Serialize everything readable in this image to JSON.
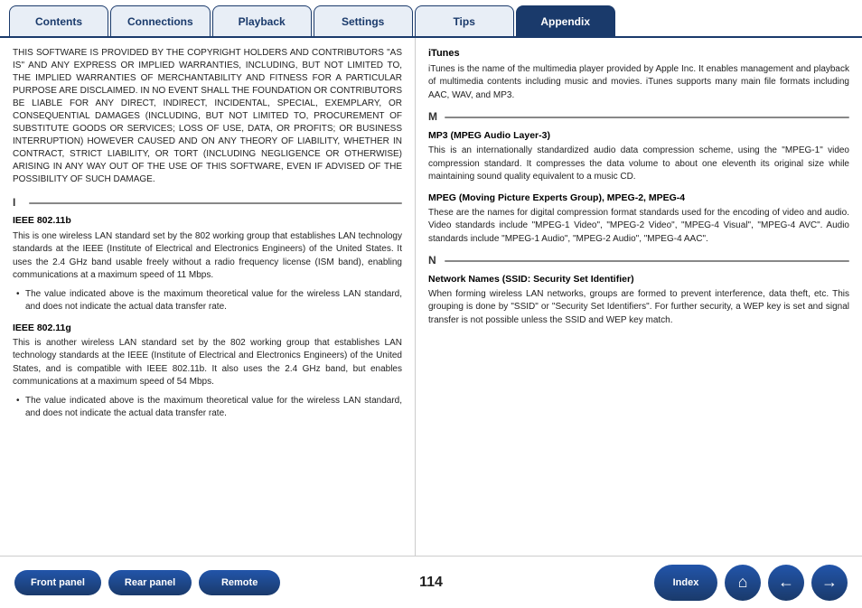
{
  "tabs": [
    {
      "label": "Contents",
      "active": false
    },
    {
      "label": "Connections",
      "active": false
    },
    {
      "label": "Playback",
      "active": false
    },
    {
      "label": "Settings",
      "active": false
    },
    {
      "label": "Tips",
      "active": false
    },
    {
      "label": "Appendix",
      "active": true
    }
  ],
  "left": {
    "copyright": "THIS SOFTWARE IS PROVIDED BY THE COPYRIGHT HOLDERS AND CONTRIBUTORS \"AS IS\" AND ANY EXPRESS OR IMPLIED WARRANTIES, INCLUDING, BUT NOT LIMITED TO, THE IMPLIED WARRANTIES OF MERCHANTABILITY AND FITNESS FOR A PARTICULAR PURPOSE ARE DISCLAIMED. IN NO EVENT SHALL THE FOUNDATION OR CONTRIBUTORS BE LIABLE FOR ANY DIRECT, INDIRECT, INCIDENTAL, SPECIAL, EXEMPLARY, OR CONSEQUENTIAL DAMAGES (INCLUDING, BUT NOT LIMITED TO, PROCUREMENT OF SUBSTITUTE GOODS OR SERVICES; LOSS OF USE, DATA, OR PROFITS; OR BUSINESS INTERRUPTION) HOWEVER CAUSED AND ON ANY THEORY OF LIABILITY, WHETHER IN CONTRACT, STRICT LIABILITY, OR TORT (INCLUDING NEGLIGENCE OR OTHERWISE) ARISING IN ANY WAY OUT OF THE USE OF THIS SOFTWARE, EVEN IF ADVISED OF THE POSSIBILITY OF SUCH DAMAGE.",
    "section_i_letter": "I",
    "ieee_802_11b_title": "IEEE 802.11b",
    "ieee_802_11b_body": "This is one wireless LAN standard set by the 802 working group that establishes LAN technology standards at the IEEE (Institute of Electrical and Electronics Engineers) of the United States. It uses the 2.4 GHz band usable freely without a radio frequency license (ISM band), enabling communications at a maximum speed of 11 Mbps.",
    "ieee_802_11b_bullet": "The value indicated above is the maximum theoretical value for the wireless LAN standard, and does not indicate the actual data transfer rate.",
    "ieee_802_11g_title": "IEEE 802.11g",
    "ieee_802_11g_body": "This is another wireless LAN standard set by the 802 working group that establishes LAN technology standards at the IEEE (Institute of Electrical and Electronics Engineers) of the United States, and is compatible with IEEE 802.11b. It also uses the 2.4 GHz band, but enables communications at a maximum speed of 54 Mbps.",
    "ieee_802_11g_bullet": "The value indicated above is the maximum theoretical value for the wireless LAN standard, and does not indicate the actual data transfer rate."
  },
  "right": {
    "itunes_title": "iTunes",
    "itunes_body": "iTunes is the name of the multimedia player provided by Apple Inc. It enables management and playback of multimedia contents including music and movies. iTunes supports many main file formats including AAC, WAV, and MP3.",
    "section_m_letter": "M",
    "mp3_title": "MP3 (MPEG Audio Layer-3)",
    "mp3_body": "This is an internationally standardized audio data compression scheme, using the \"MPEG-1\" video compression standard. It compresses the data volume to about one eleventh its original size while maintaining sound quality equivalent to a music CD.",
    "mpeg_title": "MPEG (Moving Picture Experts Group), MPEG-2, MPEG-4",
    "mpeg_body": "These are the names for digital compression format standards used for the encoding of video and audio. Video standards include \"MPEG-1 Video\", \"MPEG-2 Video\", \"MPEG-4 Visual\", \"MPEG-4 AVC\". Audio standards include \"MPEG-1 Audio\", \"MPEG-2 Audio\", \"MPEG-4 AAC\".",
    "section_n_letter": "N",
    "network_title": "Network Names (SSID: Security Set Identifier)",
    "network_body": "When forming wireless LAN networks, groups are formed to prevent interference, data theft, etc. This grouping is done by \"SSID\" or \"Security Set Identifiers\". For further security, a WEP key is set and signal transfer is not possible unless the SSID and WEP key match."
  },
  "footer": {
    "front_panel": "Front panel",
    "rear_panel": "Rear panel",
    "remote": "Remote",
    "page_number": "114",
    "index": "Index",
    "home_icon": "⌂",
    "back_icon": "←",
    "forward_icon": "→"
  }
}
